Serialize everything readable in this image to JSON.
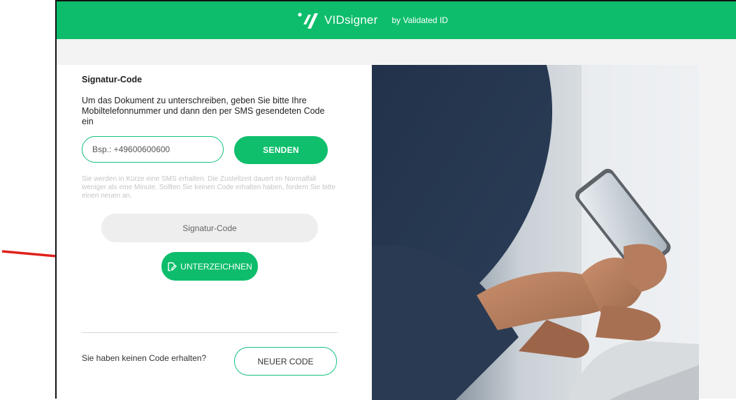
{
  "header": {
    "brand_name": "VIDsigner",
    "byline": "by Validated ID",
    "color": "#0dbd6b"
  },
  "form": {
    "title": "Signatur-Code",
    "description": "Um das Dokument zu unterschreiben, geben Sie bitte Ihre Mobiltelefonnummer und dann den per SMS gesendeten Code ein",
    "phone_placeholder": "Bsp.: +49600600600",
    "send_label": "SENDEN",
    "hint": "Sie werden in Kürze eine SMS erhalten. Die Zustellzeit dauert im Normalfall weniger als eine Minute. Sollten Sie keinen Code erhalten haben, fordern Sie bitte einen neuen an.",
    "code_placeholder": "Signatur-Code",
    "sign_label": "UNTERZEICHNEN",
    "no_code_text": "Sie haben keinen Code erhalten?",
    "new_code_label": "NEUER CODE"
  },
  "icons": {
    "logo": "vidsigner-logo-icon",
    "sign": "document-edit-icon",
    "annotation": "red-arrow-icon"
  },
  "colors": {
    "accent": "#0dbd6b",
    "annotation_arrow": "#e0211b"
  }
}
